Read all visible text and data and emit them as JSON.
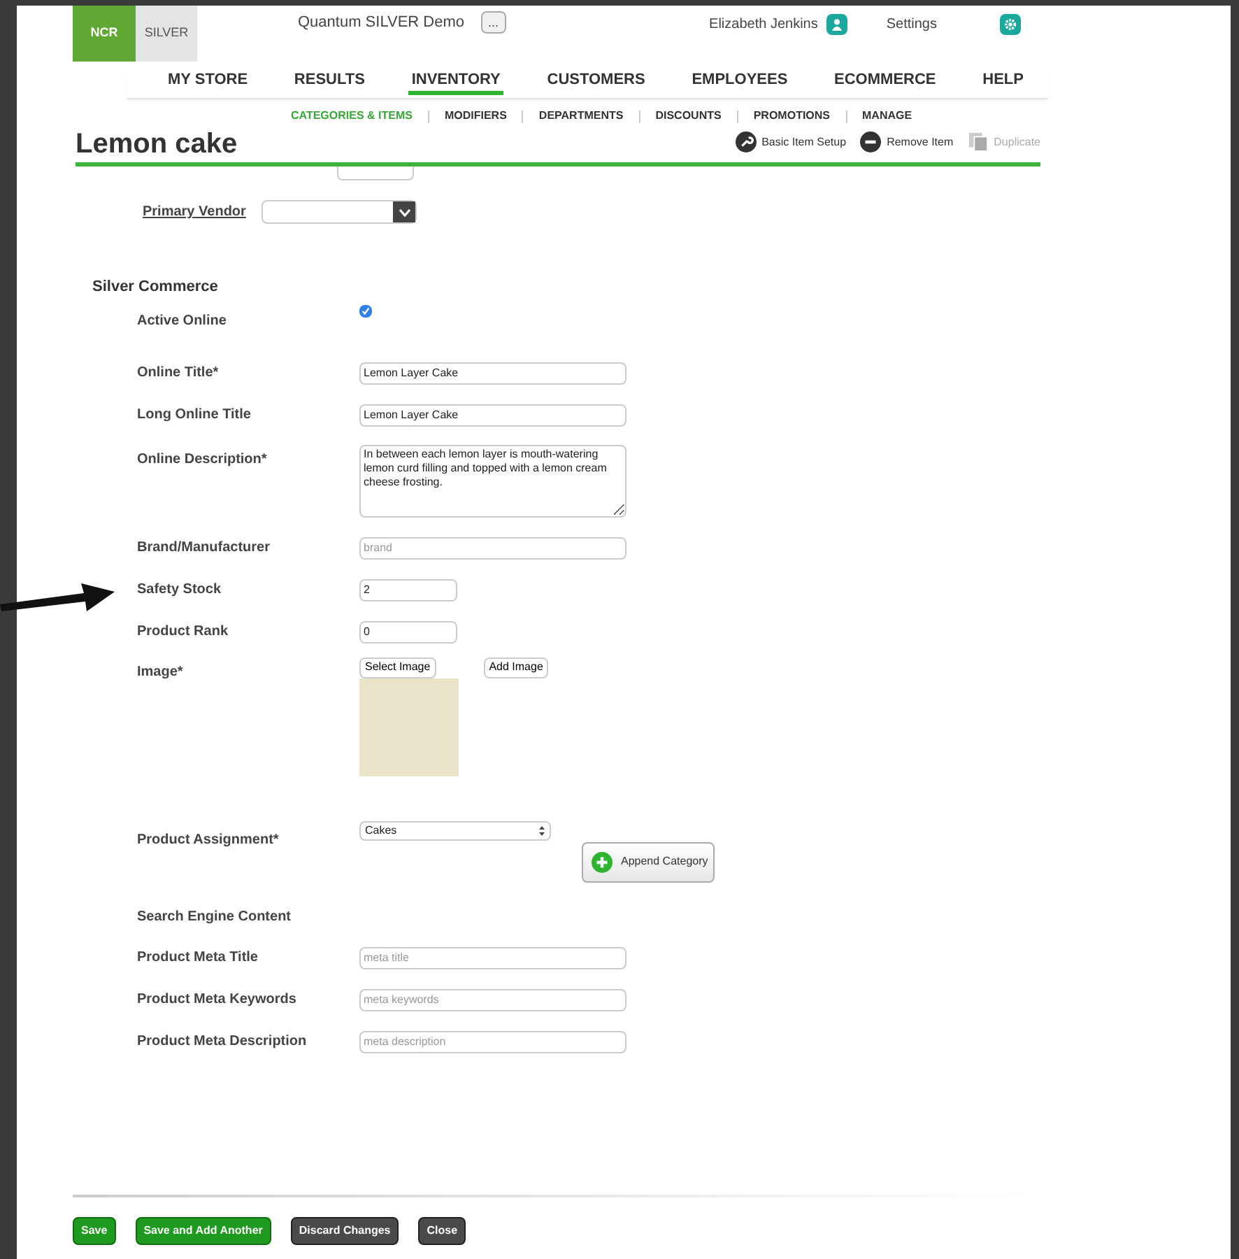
{
  "header": {
    "logo_brand": "NCR",
    "logo_product": "SILVER",
    "store_name": "Quantum SILVER Demo",
    "store_menu": "...",
    "user": "Elizabeth Jenkins",
    "settings": "Settings"
  },
  "main_nav": [
    {
      "label": "MY STORE",
      "selected": false
    },
    {
      "label": "RESULTS",
      "selected": false
    },
    {
      "label": "INVENTORY",
      "selected": true
    },
    {
      "label": "CUSTOMERS",
      "selected": false
    },
    {
      "label": "EMPLOYEES",
      "selected": false
    },
    {
      "label": "ECOMMERCE",
      "selected": false
    },
    {
      "label": "HELP",
      "selected": false
    }
  ],
  "sub_nav": [
    {
      "label": "CATEGORIES & ITEMS",
      "selected": true
    },
    {
      "label": "MODIFIERS",
      "selected": false
    },
    {
      "label": "DEPARTMENTS",
      "selected": false
    },
    {
      "label": "DISCOUNTS",
      "selected": false
    },
    {
      "label": "PROMOTIONS",
      "selected": false
    },
    {
      "label": "MANAGE",
      "selected": false
    }
  ],
  "page_title": "Lemon cake",
  "actions": [
    {
      "label": "Basic Item Setup",
      "kind": "wrench",
      "disabled": false
    },
    {
      "label": "Remove Item",
      "kind": "minus",
      "disabled": false
    },
    {
      "label": "Duplicate",
      "kind": "copy",
      "disabled": true
    }
  ],
  "primary_vendor": {
    "label": "Primary Vendor"
  },
  "section_title": "Silver Commerce",
  "fields": [
    {
      "kind": "checkbox",
      "label": "Active Online",
      "checked": true
    },
    {
      "kind": "text",
      "label": "Online Title*",
      "value": "Lemon Layer Cake"
    },
    {
      "kind": "text",
      "label": "Long Online Title",
      "value": "Lemon Layer Cake"
    },
    {
      "kind": "textarea",
      "label": "Online Description*",
      "value": "In between each lemon layer is mouth-watering lemon curd filling and topped with a lemon cream cheese frosting."
    },
    {
      "kind": "text",
      "label": "Brand/Manufacturer",
      "placeholder": "brand"
    },
    {
      "kind": "short",
      "label": "Safety Stock",
      "value": "2"
    },
    {
      "kind": "short",
      "label": "Product Rank",
      "value": "0"
    },
    {
      "kind": "image",
      "label": "Image*",
      "select": "Select Image",
      "add": "Add Image"
    },
    {
      "kind": "select",
      "label": "Product Assignment*",
      "value": "Cakes",
      "append": "Append Category"
    },
    {
      "kind": "heading",
      "label": "Search Engine Content"
    },
    {
      "kind": "text",
      "label": "Product Meta Title",
      "placeholder": "meta title"
    },
    {
      "kind": "text",
      "label": "Product Meta Keywords",
      "placeholder": "meta keywords"
    },
    {
      "kind": "text",
      "label": "Product Meta Description",
      "placeholder": "meta description"
    }
  ],
  "footer_buttons": [
    {
      "label": "Save",
      "kind": "primary"
    },
    {
      "label": "Save and Add Another",
      "kind": "primary"
    },
    {
      "label": "Discard Changes",
      "kind": "dark"
    },
    {
      "label": "Close",
      "kind": "dark"
    }
  ]
}
